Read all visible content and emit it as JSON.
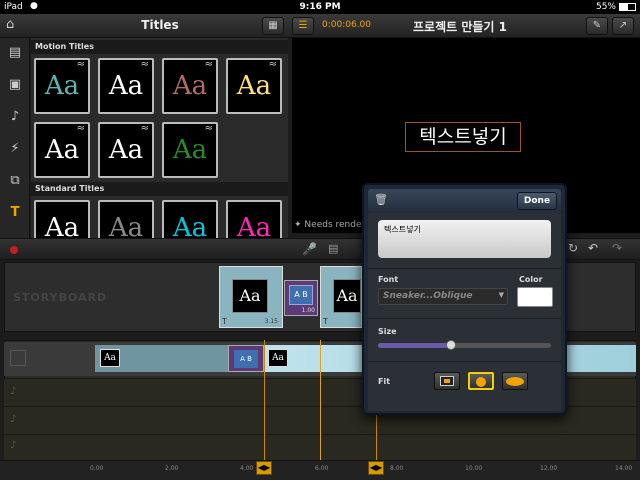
{
  "status_bar": {
    "device": "iPad",
    "time": "9:16 PM",
    "battery": "55%",
    "battery_level": 0.55
  },
  "toolbar": {
    "panel_title": "Titles",
    "timecode": "0:00:06.00",
    "project_title": "프로젝트 만들기 1"
  },
  "browser": {
    "motion_header": "Motion Titles",
    "standard_header": "Standard Titles",
    "motion_titles": [
      {
        "label": "Aa",
        "color": "#5bb5b5"
      },
      {
        "label": "Aa",
        "color": "#ffffff"
      },
      {
        "label": "Aa",
        "color": "#b06a6a"
      },
      {
        "label": "Aa",
        "color": "#ffe07a"
      },
      {
        "label": "Aa",
        "color": "#ffffff"
      },
      {
        "label": "Aa",
        "color": "#ffffff"
      },
      {
        "label": "Aa",
        "color": "#2a8a2a"
      }
    ],
    "standard_titles": [
      {
        "label": "Aa",
        "color": "#ffffff"
      },
      {
        "label": "Aa",
        "color": "#888888"
      },
      {
        "label": "Aa",
        "color": "#00c8e0"
      },
      {
        "label": "Aa",
        "color": "#ff2ab0"
      }
    ]
  },
  "preview": {
    "text": "텍스트넣기",
    "needs_render": "Needs render"
  },
  "storyboard": {
    "label": "STORYBOARD",
    "clip1": {
      "label": "Aa",
      "duration": "3.15"
    },
    "transition": {
      "label": "A B",
      "duration": "1.00"
    },
    "clip2": {
      "label": "Aa"
    }
  },
  "timeline": {
    "clip_a": "Aa",
    "transition": "A B",
    "clip_b": "Aa",
    "ruler": [
      "0.00",
      "2.00",
      "4.00",
      "6.00",
      "8.00",
      "10.00",
      "12.00",
      "14.00"
    ]
  },
  "popover": {
    "done": "Done",
    "text_value": "텍스트넣기",
    "font_label": "Font",
    "font_value": "Sneaker...Oblique",
    "color_label": "Color",
    "color_value": "#ffffff",
    "size_label": "Size",
    "size_value": 0.42,
    "fit_label": "Fit"
  }
}
